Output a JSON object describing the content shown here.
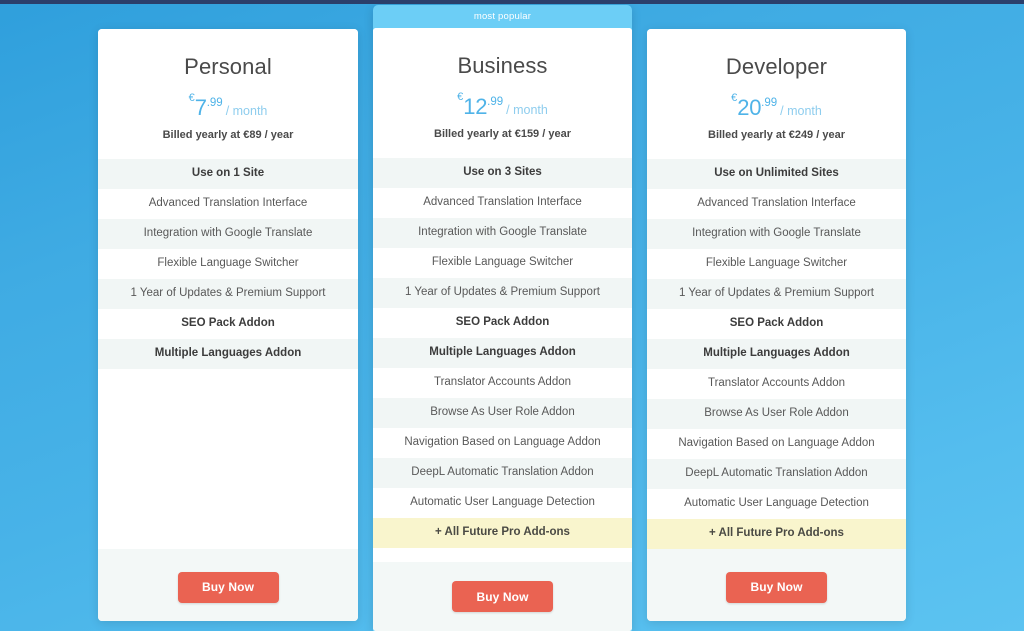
{
  "theme": {
    "background_start": "#2f9fdc",
    "background_end": "#5cc3f1",
    "top_strip": "#2b3f6b",
    "accent_blue": "#4fb3e8",
    "popular_banner": "#6ccef6",
    "buy_button": "#ea6352",
    "row_alt": "#f1f6f5",
    "future_row": "#f9f5cd",
    "footer": "#f3f8f7"
  },
  "badges": {
    "most_popular": "most popular"
  },
  "buttons": {
    "buy_now": "Buy Now"
  },
  "plans": [
    {
      "id": "personal",
      "name": "Personal",
      "currency": "€",
      "amount": "7",
      "decimals": ".99",
      "period": "/ month",
      "billed": "Billed yearly at €89 / year",
      "popular": false,
      "features": [
        "Use on 1 Site",
        "Advanced Translation Interface",
        "Integration with Google Translate",
        "Flexible Language Switcher",
        "1 Year of Updates & Premium Support",
        "SEO Pack Addon",
        "Multiple Languages Addon"
      ],
      "buy_label": "Buy Now"
    },
    {
      "id": "business",
      "name": "Business",
      "currency": "€",
      "amount": "12",
      "decimals": ".99",
      "period": "/ month",
      "billed": "Billed yearly at €159 / year",
      "popular": true,
      "features": [
        "Use on 3 Sites",
        "Advanced Translation Interface",
        "Integration with Google Translate",
        "Flexible Language Switcher",
        "1 Year of Updates & Premium Support",
        "SEO Pack Addon",
        "Multiple Languages Addon",
        "Translator Accounts Addon",
        "Browse As User Role Addon",
        "Navigation Based on Language Addon",
        "DeepL Automatic Translation Addon",
        "Automatic User Language Detection",
        "+ All Future Pro Add-ons"
      ],
      "buy_label": "Buy Now"
    },
    {
      "id": "developer",
      "name": "Developer",
      "currency": "€",
      "amount": "20",
      "decimals": ".99",
      "period": "/ month",
      "billed": "Billed yearly at €249 / year",
      "popular": false,
      "features": [
        "Use on Unlimited Sites",
        "Advanced Translation Interface",
        "Integration with Google Translate",
        "Flexible Language Switcher",
        "1 Year of Updates & Premium Support",
        "SEO Pack Addon",
        "Multiple Languages Addon",
        "Translator Accounts Addon",
        "Browse As User Role Addon",
        "Navigation Based on Language Addon",
        "DeepL Automatic Translation Addon",
        "Automatic User Language Detection",
        "+ All Future Pro Add-ons"
      ],
      "buy_label": "Buy Now"
    }
  ]
}
